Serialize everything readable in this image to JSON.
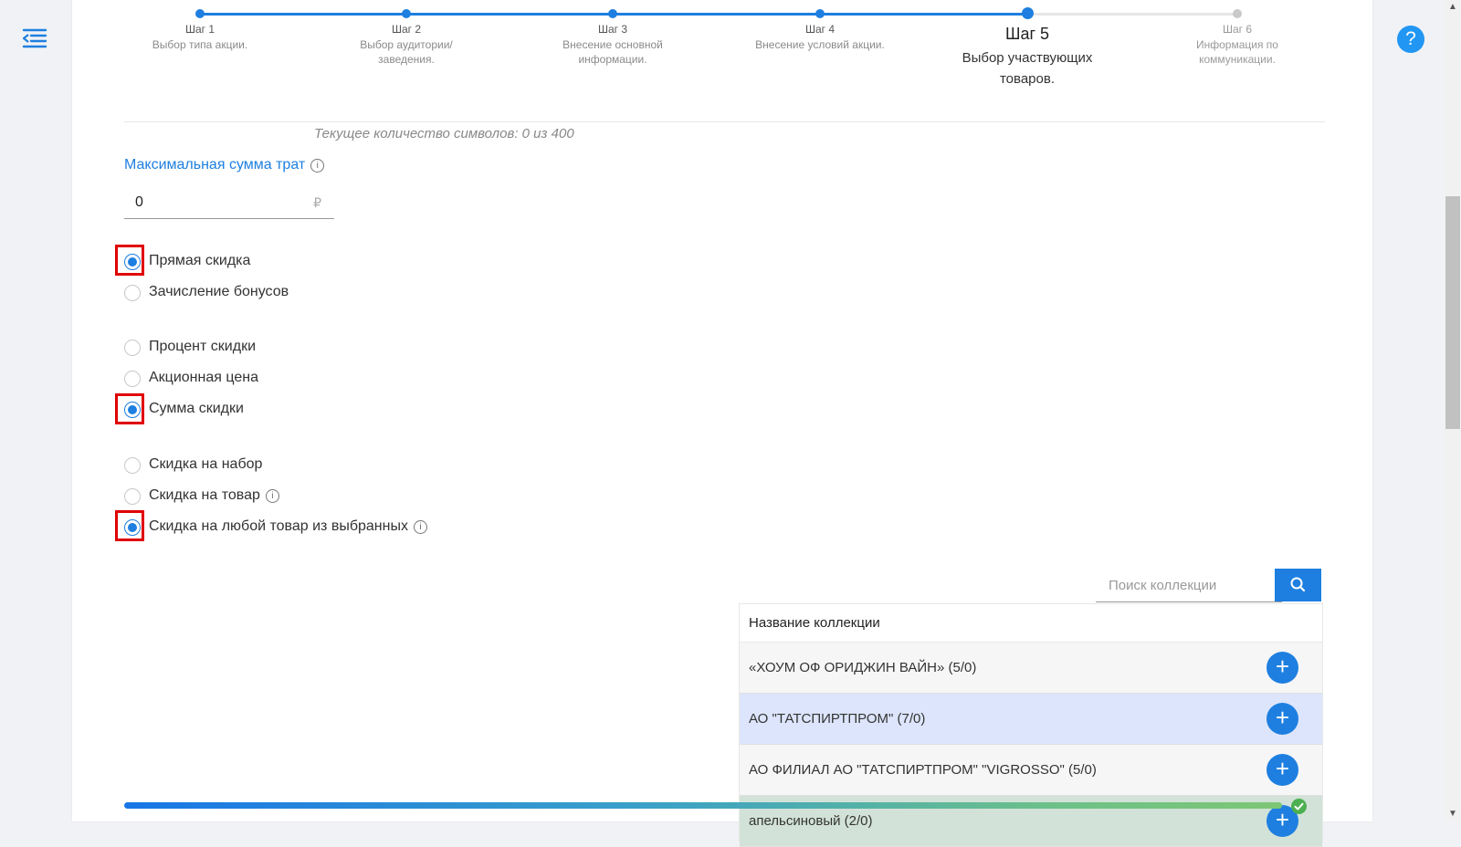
{
  "steps": [
    {
      "title": "Шаг 1",
      "desc": "Выбор типа акции."
    },
    {
      "title": "Шаг 2",
      "desc": "Выбор аудитории/заведения."
    },
    {
      "title": "Шаг 3",
      "desc": "Внесение основной информации."
    },
    {
      "title": "Шаг 4",
      "desc": "Внесение условий акции."
    },
    {
      "title": "Шаг 5",
      "desc": "Выбор участвующих товаров."
    },
    {
      "title": "Шаг 6",
      "desc": "Информация по коммуникации."
    }
  ],
  "active_step": 5,
  "char_counter": "Текущее количество символов: 0 из 400",
  "max_spend": {
    "label": "Максимальная сумма трат",
    "value": "0",
    "currency": "₽"
  },
  "discount_kind": {
    "options": [
      "Прямая скидка",
      "Зачисление бонусов"
    ],
    "selected": "Прямая скидка"
  },
  "discount_value_type": {
    "options": [
      "Процент скидки",
      "Акционная цена",
      "Сумма скидки"
    ],
    "selected": "Сумма скидки"
  },
  "discount_target": {
    "options": [
      "Скидка на набор",
      "Скидка на товар",
      "Скидка на любой товар из выбранных"
    ],
    "selected": "Скидка на любой товар из выбранных"
  },
  "collections": {
    "search_placeholder": "Поиск коллекции",
    "header": "Название коллекции",
    "rows": [
      "«ХОУМ ОФ ОРИДЖИН ВАЙН» (5/0)",
      "АО \"ТАТСПИРТПРОМ\" (7/0)",
      "АО ФИЛИАЛ АО \"ТАТСПИРТПРОМ\" \"VIGROSSO\" (5/0)",
      "апельсиновый (2/0)"
    ]
  },
  "colors": {
    "accent": "#1e7fe0",
    "highlight_box": "#e00000",
    "success": "#4caf50"
  },
  "icons": [
    "menu-collapse-icon",
    "help-icon",
    "info-icon",
    "search-icon",
    "plus-icon",
    "check-icon"
  ],
  "help_label": "?"
}
